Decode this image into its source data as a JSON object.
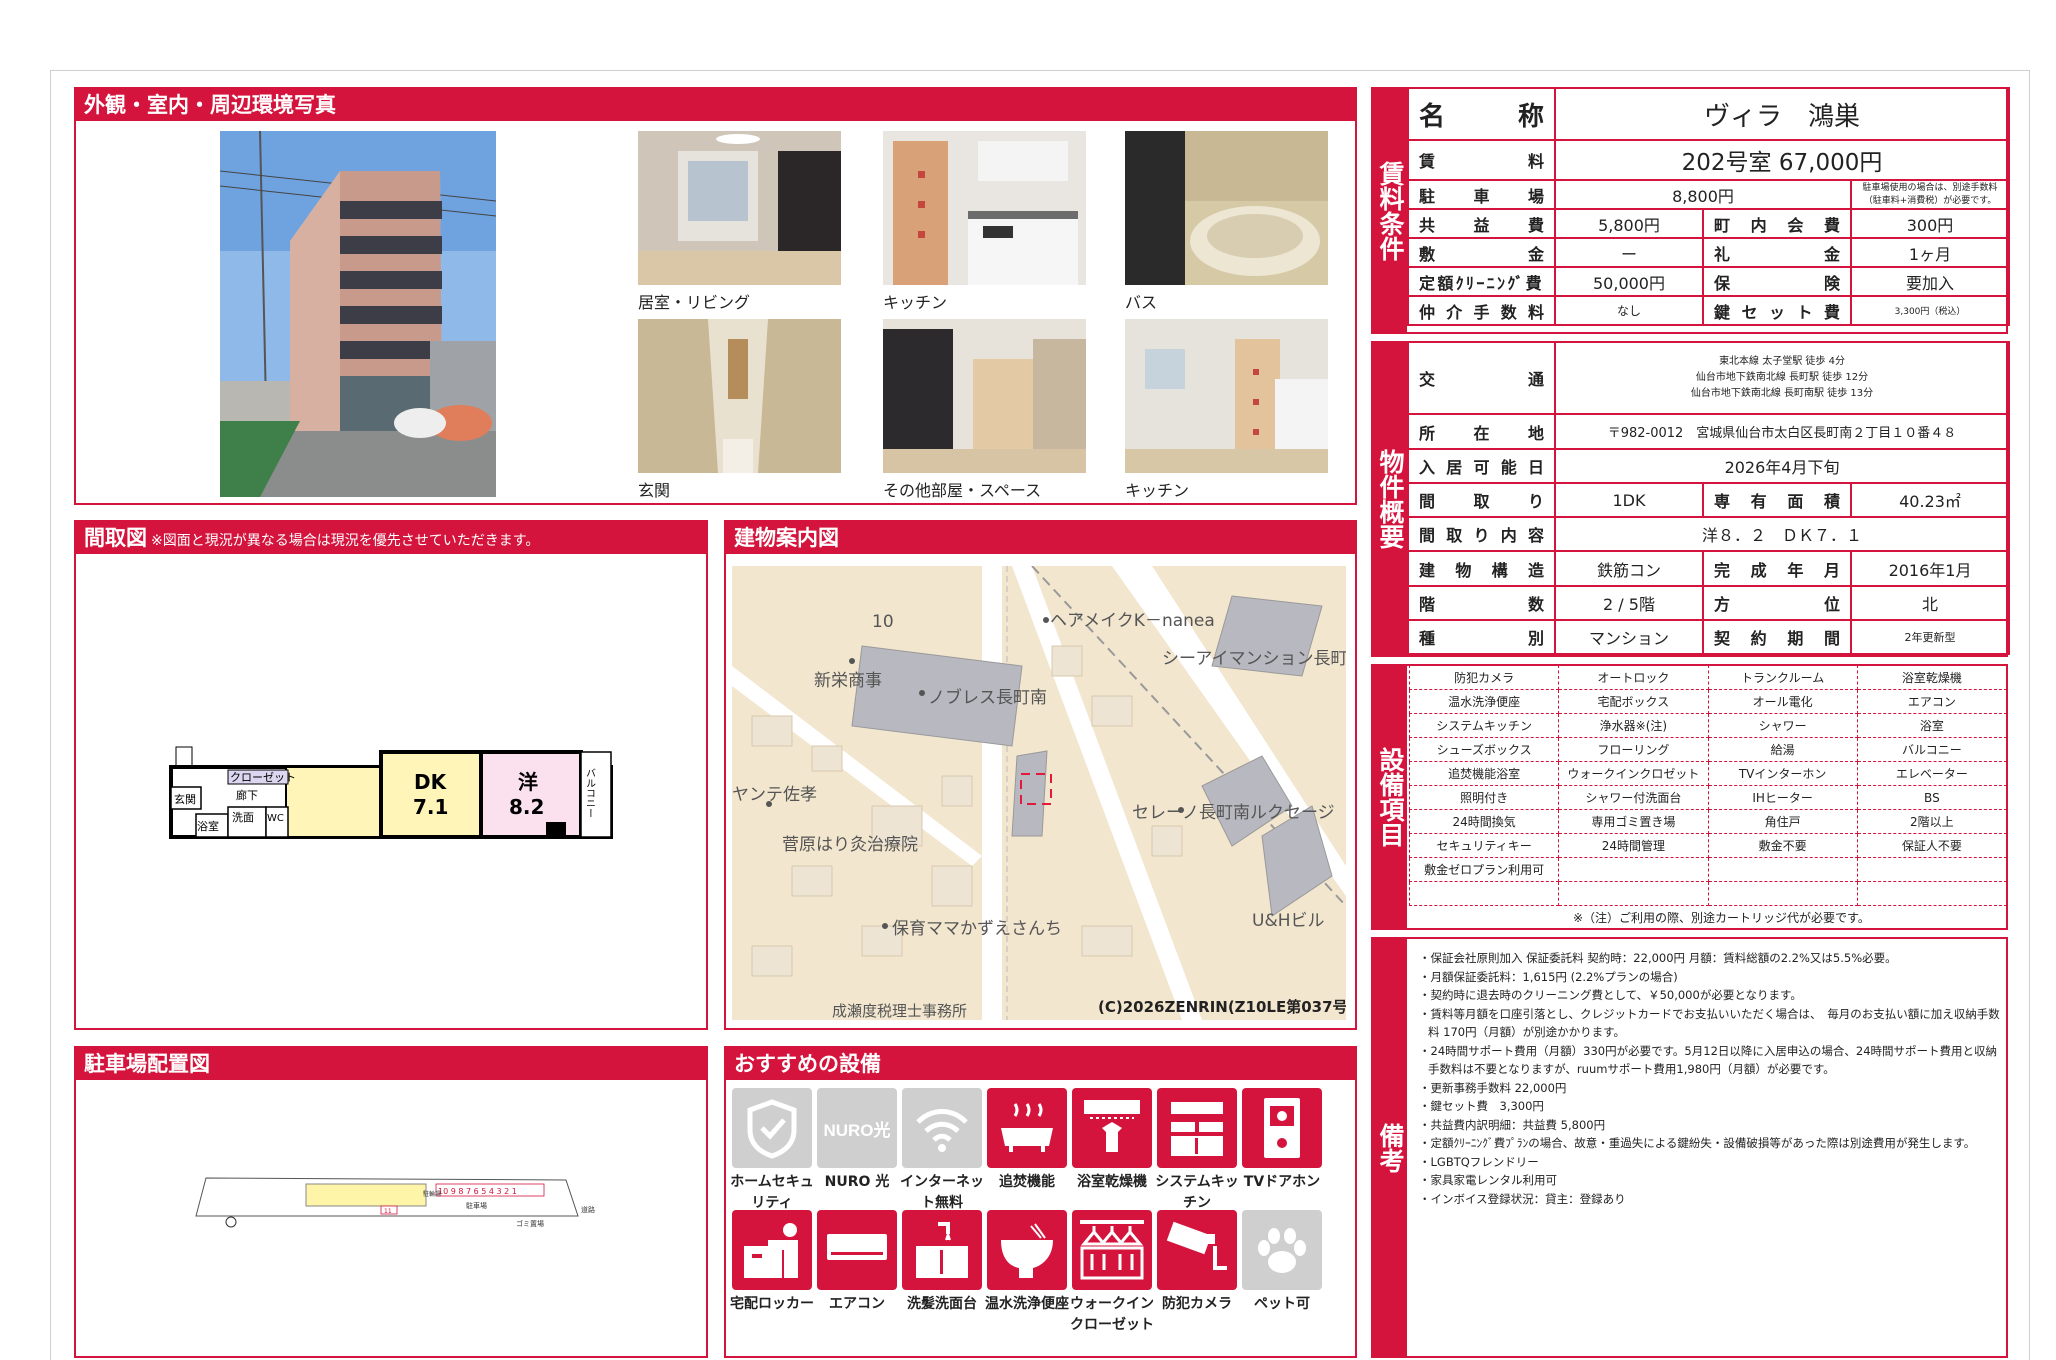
{
  "photos": {
    "title": "外観・室内・周辺環境写真",
    "items": [
      {
        "caption": "居室・リビング"
      },
      {
        "caption": "キッチン"
      },
      {
        "caption": "バス"
      },
      {
        "caption": "玄関"
      },
      {
        "caption": "その他部屋・スペース"
      },
      {
        "caption": "キッチン"
      }
    ]
  },
  "floorplan": {
    "title": "間取図",
    "note": "※図面と現況が異なる場合は現況を優先させていただきます。",
    "labels": {
      "closet": "クローゼット",
      "entrance": "玄関",
      "hall": "廊下",
      "wash": "洗面",
      "bath": "浴室",
      "wc": "WC",
      "dk": "DK",
      "dk_size": "7.1",
      "room": "洋",
      "room_size": "8.2",
      "balcony": "バルコニー"
    }
  },
  "map": {
    "title": "建物案内図",
    "labels": [
      "10",
      "ヘアメイクK－nanea",
      "シーアイマンション長町",
      "新栄商事",
      "ノブレス長町南",
      "ヤンテ佐孝",
      "セレーノ長町南ルクセージ",
      "菅原はり灸治療院",
      "U&Hビル",
      "保育ママかずえさんち",
      "成瀬度税理士事務所"
    ],
    "copyright": "(C)2026ZENRIN(Z10LE第037号)"
  },
  "parking": {
    "title": "駐車場配置図",
    "labels": {
      "slots": "10 9 8 7 6 5 4 3 2 1",
      "lot": "駐車場",
      "road": "道路",
      "garbage": "ゴミ置場",
      "bike": "駐輪場",
      "slot11": "11"
    }
  },
  "recommended": {
    "title": "おすすめの設備",
    "items": [
      {
        "label": "ホームセキュリティ",
        "icon": "shield-icon",
        "active": false
      },
      {
        "label": "NURO 光",
        "icon": "nuro-icon",
        "active": false
      },
      {
        "label": "インターネット無料",
        "icon": "wifi-icon",
        "active": false
      },
      {
        "label": "追焚機能",
        "icon": "bathtub-icon",
        "active": true
      },
      {
        "label": "浴室乾燥機",
        "icon": "bath-dryer-icon",
        "active": true
      },
      {
        "label": "システムキッチン",
        "icon": "kitchen-icon",
        "active": true
      },
      {
        "label": "TVドアホン",
        "icon": "intercom-icon",
        "active": true
      },
      {
        "label": "宅配ロッカー",
        "icon": "delivery-locker-icon",
        "active": true
      },
      {
        "label": "エアコン",
        "icon": "aircon-icon",
        "active": true
      },
      {
        "label": "洗髪洗面台",
        "icon": "washbasin-icon",
        "active": true
      },
      {
        "label": "温水洗浄便座",
        "icon": "toilet-icon",
        "active": true
      },
      {
        "label": "ウォークインクローゼット",
        "icon": "closet-icon",
        "active": true
      },
      {
        "label": "防犯カメラ",
        "icon": "camera-icon",
        "active": true
      },
      {
        "label": "ペット可",
        "icon": "paw-icon",
        "active": false
      }
    ]
  },
  "rent": {
    "section": "賃料条件",
    "name_label": "名称",
    "name": "ヴィラ　鴻巣",
    "rent_label": "賃料",
    "rent": "202号室 67,000円",
    "parking_label": "駐車場",
    "parking": "8,800円",
    "parking_note": "駐車場使用の場合は、別途手数料（駐車料+消費税）が必要です。",
    "common_label": "共益費",
    "common": "5,800円",
    "town_label": "町内会費",
    "town": "300円",
    "deposit_label": "敷金",
    "deposit": "ー",
    "keymoney_label": "礼金",
    "keymoney": "1ヶ月",
    "cleaning_label": "定額ｸﾘｰﾆﾝｸﾞ費",
    "cleaning": "50,000円",
    "insurance_label": "保険",
    "insurance": "要加入",
    "brokerage_label": "仲介手数料",
    "brokerage": "なし",
    "keyset_label": "鍵セット費",
    "keyset": "3,300円（税込）"
  },
  "property": {
    "section": "物件概要",
    "transport_label": "交通",
    "transport": [
      "東北本線 太子堂駅 徒歩 4分",
      "仙台市地下鉄南北線 長町駅 徒歩 12分",
      "仙台市地下鉄南北線 長町南駅 徒歩 13分"
    ],
    "address_label": "所在地",
    "address": "〒982-0012　宮城県仙台市太白区長町南２丁目１０番４８",
    "movein_label": "入居可能日",
    "movein": "2026年4月下旬",
    "layout_label": "間取り",
    "layout": "1DK",
    "area_label": "専有面積",
    "area": "40.23㎡",
    "layout_detail_label": "間取り内容",
    "layout_detail": "洋８．２　ＤＫ７．１",
    "structure_label": "建物構造",
    "structure": "鉄筋コン",
    "built_label": "完成年月",
    "built": "2016年1月",
    "floor_label": "階数",
    "floor": "2 / 5階",
    "direction_label": "方位",
    "direction": "北",
    "type_label": "種別",
    "type": "マンション",
    "contract_label": "契約期間",
    "contract": "2年更新型"
  },
  "equipment": {
    "section": "設備項目",
    "rows": [
      [
        "防犯カメラ",
        "オートロック",
        "トランクルーム",
        "浴室乾燥機"
      ],
      [
        "温水洗浄便座",
        "宅配ボックス",
        "オール電化",
        "エアコン"
      ],
      [
        "システムキッチン",
        "浄水器※(注)",
        "シャワー",
        "浴室"
      ],
      [
        "シューズボックス",
        "フローリング",
        "給湯",
        "バルコニー"
      ],
      [
        "追焚機能浴室",
        "ウォークインクロゼット",
        "TVインターホン",
        "エレベーター"
      ],
      [
        "照明付き",
        "シャワー付洗面台",
        "IHヒーター",
        "BS"
      ],
      [
        "24時間換気",
        "専用ゴミ置き場",
        "角住戸",
        "2階以上"
      ],
      [
        "セキュリティキー",
        "24時間管理",
        "敷金不要",
        "保証人不要"
      ],
      [
        "敷金ゼロプラン利用可",
        "",
        "",
        ""
      ],
      [
        "",
        "",
        "",
        ""
      ]
    ],
    "note": "※（注）ご利用の際、別途カートリッジ代が必要です。"
  },
  "remarks": {
    "section": "備考",
    "lines": [
      "・保証会社原則加入 保証委託料 契約時：22,000円 月額：賃料総額の2.2%又は5.5%必要。",
      "・月額保証委託料：1,615円 (2.2%プランの場合)",
      "・契約時に退去時のクリーニング費として、￥50,000が必要となります。",
      "・賃料等月額を口座引落とし、クレジットカードでお支払いいただく場合は、　毎月のお支払い額に加え収納手数料 170円（月額）が別途かかります。",
      "・24時間サポート費用（月額）330円が必要です。5月12日以降に入居申込の場合、24時間サポート費用と収納手数料は不要となりますが、ruumサポート費用1,980円（月額）が必要です。",
      "・更新事務手数料 22,000円",
      "・鍵セット費　3,300円",
      "・共益費内訳明細：共益費 5,800円",
      "・定額ｸﾘｰﾆﾝｸﾞ費ﾌﾟﾗﾝの場合、故意・重過失による鍵紛失・設備破損等があった際は別途費用が発生します。",
      "・LGBTQフレンドリー",
      "・家具家電レンタル利用可",
      "・インボイス登録状況：貸主：登録あり"
    ]
  },
  "colors": {
    "accent": "#d4143c"
  }
}
